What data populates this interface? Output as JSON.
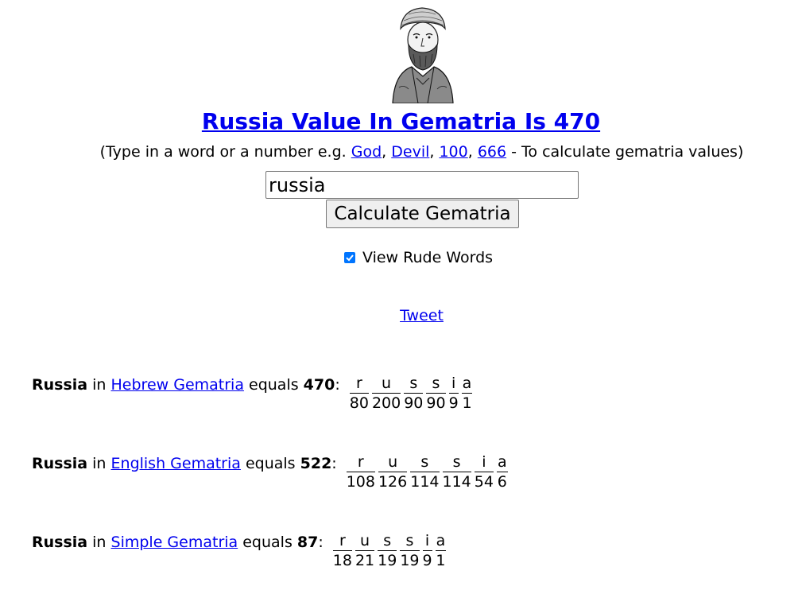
{
  "header": {
    "title": "Russia Value In Gematria Is 470",
    "subtitle_prefix": "(Type in a word or a number e.g. ",
    "examples": [
      "God",
      "Devil",
      "100",
      "666"
    ],
    "separator": ", ",
    "subtitle_suffix": " - To calculate gematria values)"
  },
  "form": {
    "search_value": "russia",
    "calculate_label": "Calculate Gematria",
    "rude_words_label": "View Rude Words",
    "rude_words_checked": true
  },
  "tweet_label": "Tweet",
  "results": [
    {
      "word": "Russia",
      "in": " in ",
      "system": "Hebrew Gematria",
      "equals": " equals ",
      "total": "470",
      "colon": ":",
      "letters": [
        {
          "ch": "r",
          "val": "80"
        },
        {
          "ch": "u",
          "val": "200"
        },
        {
          "ch": "s",
          "val": "90"
        },
        {
          "ch": "s",
          "val": "90"
        },
        {
          "ch": "i",
          "val": "9"
        },
        {
          "ch": "a",
          "val": "1"
        }
      ]
    },
    {
      "word": "Russia",
      "in": " in ",
      "system": "English Gematria",
      "equals": " equals ",
      "total": "522",
      "colon": ":",
      "letters": [
        {
          "ch": "r",
          "val": "108"
        },
        {
          "ch": "u",
          "val": "126"
        },
        {
          "ch": "s",
          "val": "114"
        },
        {
          "ch": "s",
          "val": "114"
        },
        {
          "ch": "i",
          "val": "54"
        },
        {
          "ch": "a",
          "val": "6"
        }
      ]
    },
    {
      "word": "Russia",
      "in": " in ",
      "system": "Simple Gematria",
      "equals": " equals ",
      "total": "87",
      "colon": ":",
      "letters": [
        {
          "ch": "r",
          "val": "18"
        },
        {
          "ch": "u",
          "val": "21"
        },
        {
          "ch": "s",
          "val": "19"
        },
        {
          "ch": "s",
          "val": "19"
        },
        {
          "ch": "i",
          "val": "9"
        },
        {
          "ch": "a",
          "val": "1"
        }
      ]
    }
  ],
  "colors": {
    "link": "#0000ee",
    "checkbox": "#0075ff"
  },
  "icons": {
    "portrait": "maimonides-portrait-icon",
    "checkmark": "checkmark-icon"
  }
}
